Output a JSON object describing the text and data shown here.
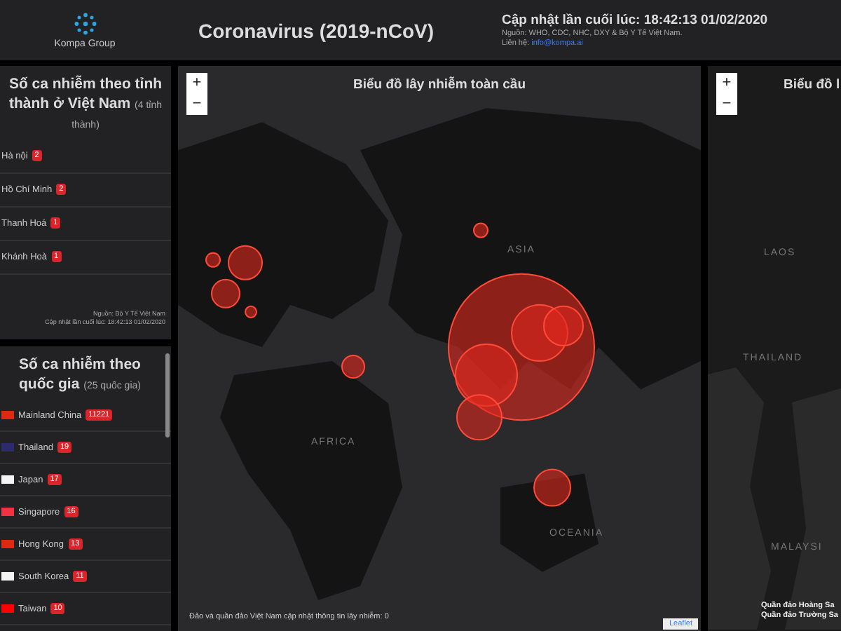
{
  "header": {
    "logo_text": "Kompa Group",
    "title": "Coronavirus (2019-nCoV)",
    "updated": "Cập nhật lần cuối lúc: 18:42:13 01/02/2020",
    "source": "Nguồn: WHO, CDC, NHC, DXY & Bộ Y Tế Việt Nam.",
    "contact_label": "Liên hệ:",
    "contact_link": "info@kompa.ai"
  },
  "vietnam_panel": {
    "title": "Số ca nhiễm theo tỉnh thành ở Việt Nam",
    "subtitle": "(4 tỉnh thành)",
    "rows": [
      {
        "name": "Hà nội",
        "count": "2"
      },
      {
        "name": "Hồ Chí Minh",
        "count": "2"
      },
      {
        "name": "Thanh Hoá",
        "count": "1"
      },
      {
        "name": "Khánh Hoà",
        "count": "1"
      }
    ],
    "source": "Nguồn: Bộ Y Tế Việt Nam",
    "updated": "Cập nhật lần cuối lúc: 18:42:13 01/02/2020"
  },
  "country_panel": {
    "title": "Số ca nhiễm theo quốc gia",
    "subtitle": "(25 quốc gia)",
    "rows": [
      {
        "name": "Mainland China",
        "count": "11221",
        "color": "#de2910"
      },
      {
        "name": "Thailand",
        "count": "19",
        "color": "#2d2a6e"
      },
      {
        "name": "Japan",
        "count": "17",
        "color": "#f4f4f4"
      },
      {
        "name": "Singapore",
        "count": "16",
        "color": "#ef3340"
      },
      {
        "name": "Hong Kong",
        "count": "13",
        "color": "#de2910"
      },
      {
        "name": "South Korea",
        "count": "11",
        "color": "#f4f4f4"
      },
      {
        "name": "Taiwan",
        "count": "10",
        "color": "#fe0000"
      }
    ]
  },
  "world_map": {
    "title": "Biểu đồ lây nhiễm toàn cầu",
    "zoom_in": "+",
    "zoom_out": "−",
    "labels": [
      "ASIA",
      "AFRICA",
      "OCEANIA"
    ],
    "footer": "Đảo và quần đảo Việt Nam cập nhật thông tin lây nhiễm: 0",
    "attribution": "Leaflet"
  },
  "vietnam_map": {
    "title": "Biểu đồ l",
    "zoom_in": "+",
    "zoom_out": "−",
    "labels": [
      "LAOS",
      "THAILAND",
      "MALAYSI"
    ],
    "islands": [
      "Quần đảo Hoàng Sa",
      "Quần đảo Trường Sa"
    ]
  }
}
